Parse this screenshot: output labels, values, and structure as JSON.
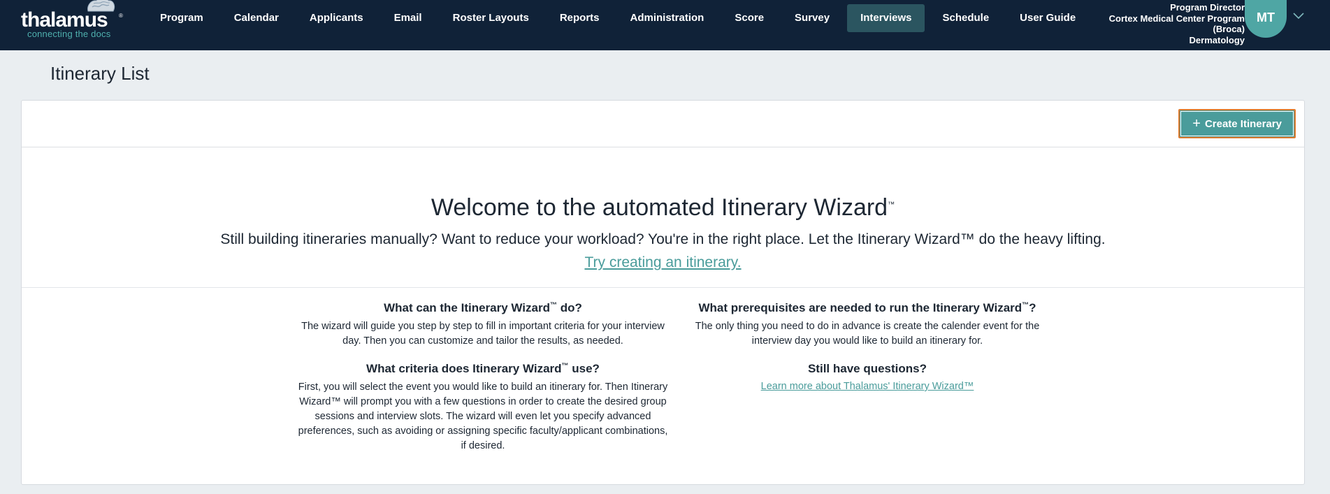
{
  "brand": {
    "wordmark": "thalamus",
    "tagline": "connecting the docs"
  },
  "nav": {
    "items": [
      {
        "label": "Program",
        "active": false
      },
      {
        "label": "Calendar",
        "active": false
      },
      {
        "label": "Applicants",
        "active": false
      },
      {
        "label": "Email",
        "active": false
      },
      {
        "label": "Roster Layouts",
        "active": false
      },
      {
        "label": "Reports",
        "active": false
      },
      {
        "label": "Administration",
        "active": false
      },
      {
        "label": "Score",
        "active": false
      },
      {
        "label": "Survey",
        "active": false
      },
      {
        "label": "Interviews",
        "active": true
      },
      {
        "label": "Schedule",
        "active": false
      },
      {
        "label": "User Guide",
        "active": false
      }
    ]
  },
  "user": {
    "role": "Program Director",
    "program": "Cortex Medical Center Program",
    "program_sub": "(Broca)",
    "specialty": "Dermatology",
    "initials": "MT"
  },
  "page": {
    "title": "Itinerary List"
  },
  "toolbar": {
    "create_label": "Create Itinerary"
  },
  "welcome": {
    "title": "Welcome to the automated Itinerary Wizard",
    "title_mark": "™",
    "subtitle": "Still building itineraries manually? Want to reduce your workload? You're in the right place. Let the Itinerary Wizard™ do the heavy lifting.",
    "try_link": " Try creating an itinerary. "
  },
  "faq": {
    "q1": {
      "title_a": "What can the Itinerary Wizard",
      "title_b": " do?",
      "body": "The wizard will guide you step by step to fill in important criteria for your interview day. Then you can customize and tailor the results, as needed."
    },
    "q2": {
      "title_a": "What prerequisites are needed to run the Itinerary Wizard",
      "title_b": "?",
      "body": "The only thing you need to do in advance is create the calender event for the interview day you would like to build an itinerary for."
    },
    "q3": {
      "title_a": "What criteria does Itinerary Wizard",
      "title_b": " use?",
      "body": "First, you will select the event you would like to build an itinerary for. Then Itinerary Wizard™ will prompt you with a few questions in order to create the desired group sessions and interview slots. The wizard will even let you specify advanced preferences, such as avoiding or assigning specific faculty/applicant combinations, if desired."
    },
    "q4": {
      "title": "Still have questions?",
      "link": " Learn more about Thalamus' Itinerary Wizard™ "
    },
    "tm": "™"
  },
  "colors": {
    "nav_bg": "#102238",
    "accent": "#4a9c9b",
    "focus_ring": "#e07b2e"
  }
}
